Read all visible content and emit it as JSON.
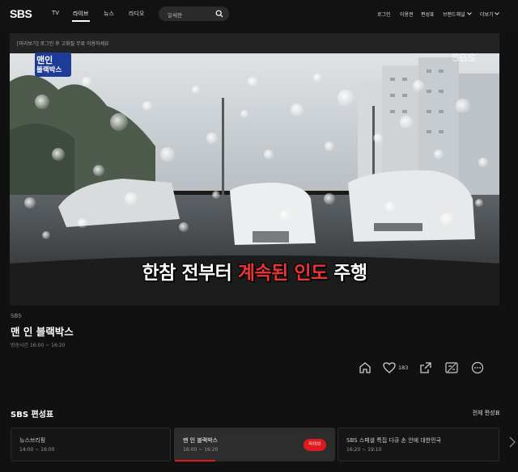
{
  "header": {
    "logo": "SBS",
    "nav": [
      "TV",
      "라이브",
      "뉴스",
      "라디오"
    ],
    "active_nav": "라이브",
    "search_placeholder": "알쎄쨘",
    "right_nav": [
      "로그인",
      "이용권",
      "편성표",
      "브랜드채널",
      "더보기"
    ]
  },
  "player": {
    "notice": "[미리보기] 로그인 후 고화질 무료 이용하세요",
    "badge_line1": "맨인",
    "badge_line2": "블랙박스",
    "watermark": "SBS",
    "caption_white_1": "한참 전부터 ",
    "caption_red": "계속된 인도",
    "caption_white_2": " 주행"
  },
  "program": {
    "channel": "SBS",
    "title": "맨 인 블랙박스",
    "airtime": "방송시간  16:00 ~ 16:20",
    "like_count": "183"
  },
  "schedule": {
    "title": "SBS 편성표",
    "all_link": "전체 편성표",
    "items": [
      {
        "title": "뉴스브리핑",
        "time": "14:00 ~ 16:00"
      },
      {
        "title": "맨 인 블랙박스",
        "time": "16:00 ~ 16:20",
        "live": "라이브"
      },
      {
        "title": "SBS 스페셜 특집 다큐 손 안에 대한민국",
        "time": "16:20 ~ 19:10"
      }
    ]
  },
  "colors": {
    "accent": "#e0191e",
    "background": "#111111",
    "badge_blue": "#1f3b9a"
  }
}
